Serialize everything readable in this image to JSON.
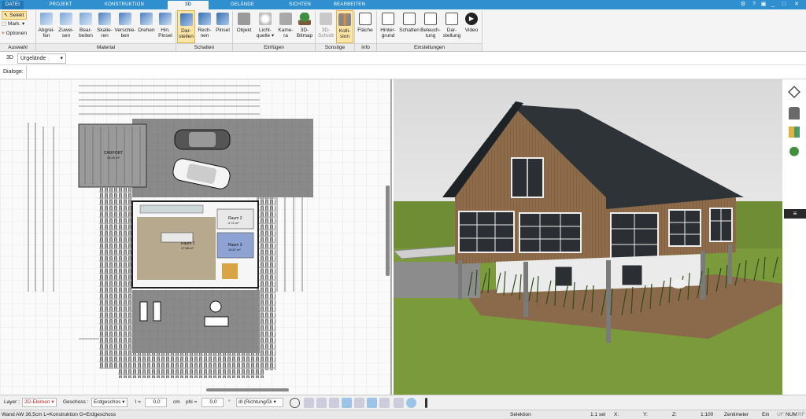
{
  "menu_tabs": [
    {
      "label": "DATEI",
      "active": false
    },
    {
      "label": "PROJEKT",
      "active": false
    },
    {
      "label": "KONSTRUKTION",
      "active": false
    },
    {
      "label": "3D",
      "active": true
    },
    {
      "label": "GELÄNDE",
      "active": false
    },
    {
      "label": "SICHTEN",
      "active": false
    },
    {
      "label": "BEARBEITEN",
      "active": false
    }
  ],
  "selection": {
    "selekt": "Selekt",
    "mark": "Mark.",
    "optionen": "Optionen",
    "group": "Auswahl"
  },
  "groups": {
    "material": "Material",
    "schatten": "Schatten",
    "einfuegen": "Einfügen",
    "sonstige": "Sonstige",
    "info": "Info",
    "einstellungen": "Einstellungen"
  },
  "buttons": {
    "abgreifen": [
      "Abgrei-",
      "fen"
    ],
    "zuweisen": [
      "Zuwei-",
      "sen"
    ],
    "bearbeiten": [
      "Bear-",
      "beiten"
    ],
    "skalieren": [
      "Skalie-",
      "ren"
    ],
    "verschieben": [
      "Verschie-",
      "ben"
    ],
    "drehen": [
      "Drehen",
      ""
    ],
    "hinpinsel": [
      "Hin.",
      "Pinsel"
    ],
    "darstellen": [
      "Dar-",
      "stellen"
    ],
    "rechnen": [
      "Rech-",
      "nen"
    ],
    "pinsel": [
      "Pinsel",
      ""
    ],
    "objekt": [
      "Objekt",
      ""
    ],
    "lichtquelle": [
      "Licht-",
      "quelle ▾"
    ],
    "kamera": [
      "Kame-",
      "ra"
    ],
    "bitmap": [
      "3D-",
      "Bitmap"
    ],
    "schnitt": [
      "3D-",
      "Schnitt"
    ],
    "kollision": [
      "Kolli-",
      "sion"
    ],
    "flaeche": [
      "Fläche",
      ""
    ],
    "hintergrund": [
      "Hinter-",
      "grund"
    ],
    "schatten2": [
      "Schatten",
      ""
    ],
    "beleuchtung": [
      "Beleuch-",
      "tung"
    ],
    "darstellung": [
      "Dar-",
      "stellung"
    ],
    "video": [
      "Video",
      ""
    ]
  },
  "view_row": {
    "mode": "3D",
    "terrain": "Urgelände"
  },
  "dialog_row": {
    "label": "Dialoge:"
  },
  "plan_labels": {
    "carport": "CARPORT",
    "carport_area": "26,00 m²",
    "raum1": "Raum 1",
    "raum1_area": "47,98 m²",
    "raum2": "Raum 2",
    "raum2_area": "2,72 m²",
    "raum3": "Raum 3",
    "raum3_area": "13,57 m²"
  },
  "statusbar": {
    "layer_label": "Layer :",
    "layer_value": "2D-Elemen",
    "geschoss_label": "Geschoss :",
    "geschoss_value": "Erdgeschos",
    "l_label": "l =",
    "l_value": "0,0",
    "cm": "cm",
    "phi_label": "phi =",
    "phi_value": "0,0",
    "deg": "°",
    "dl_value": "dl (Richtung/Di"
  },
  "footer": {
    "info": "Wand AW 36,5cm L=Konstruktion G=Erdgeschoss",
    "mode": "Selektion",
    "scale_sel": "1:1 sel",
    "x": "X:",
    "y": "Y:",
    "z": "Z:",
    "scale": "1:100",
    "unit": "Zentimeter",
    "ein": "Ein",
    "uf": "UF",
    "num": "NUM",
    "rf": "RF"
  }
}
